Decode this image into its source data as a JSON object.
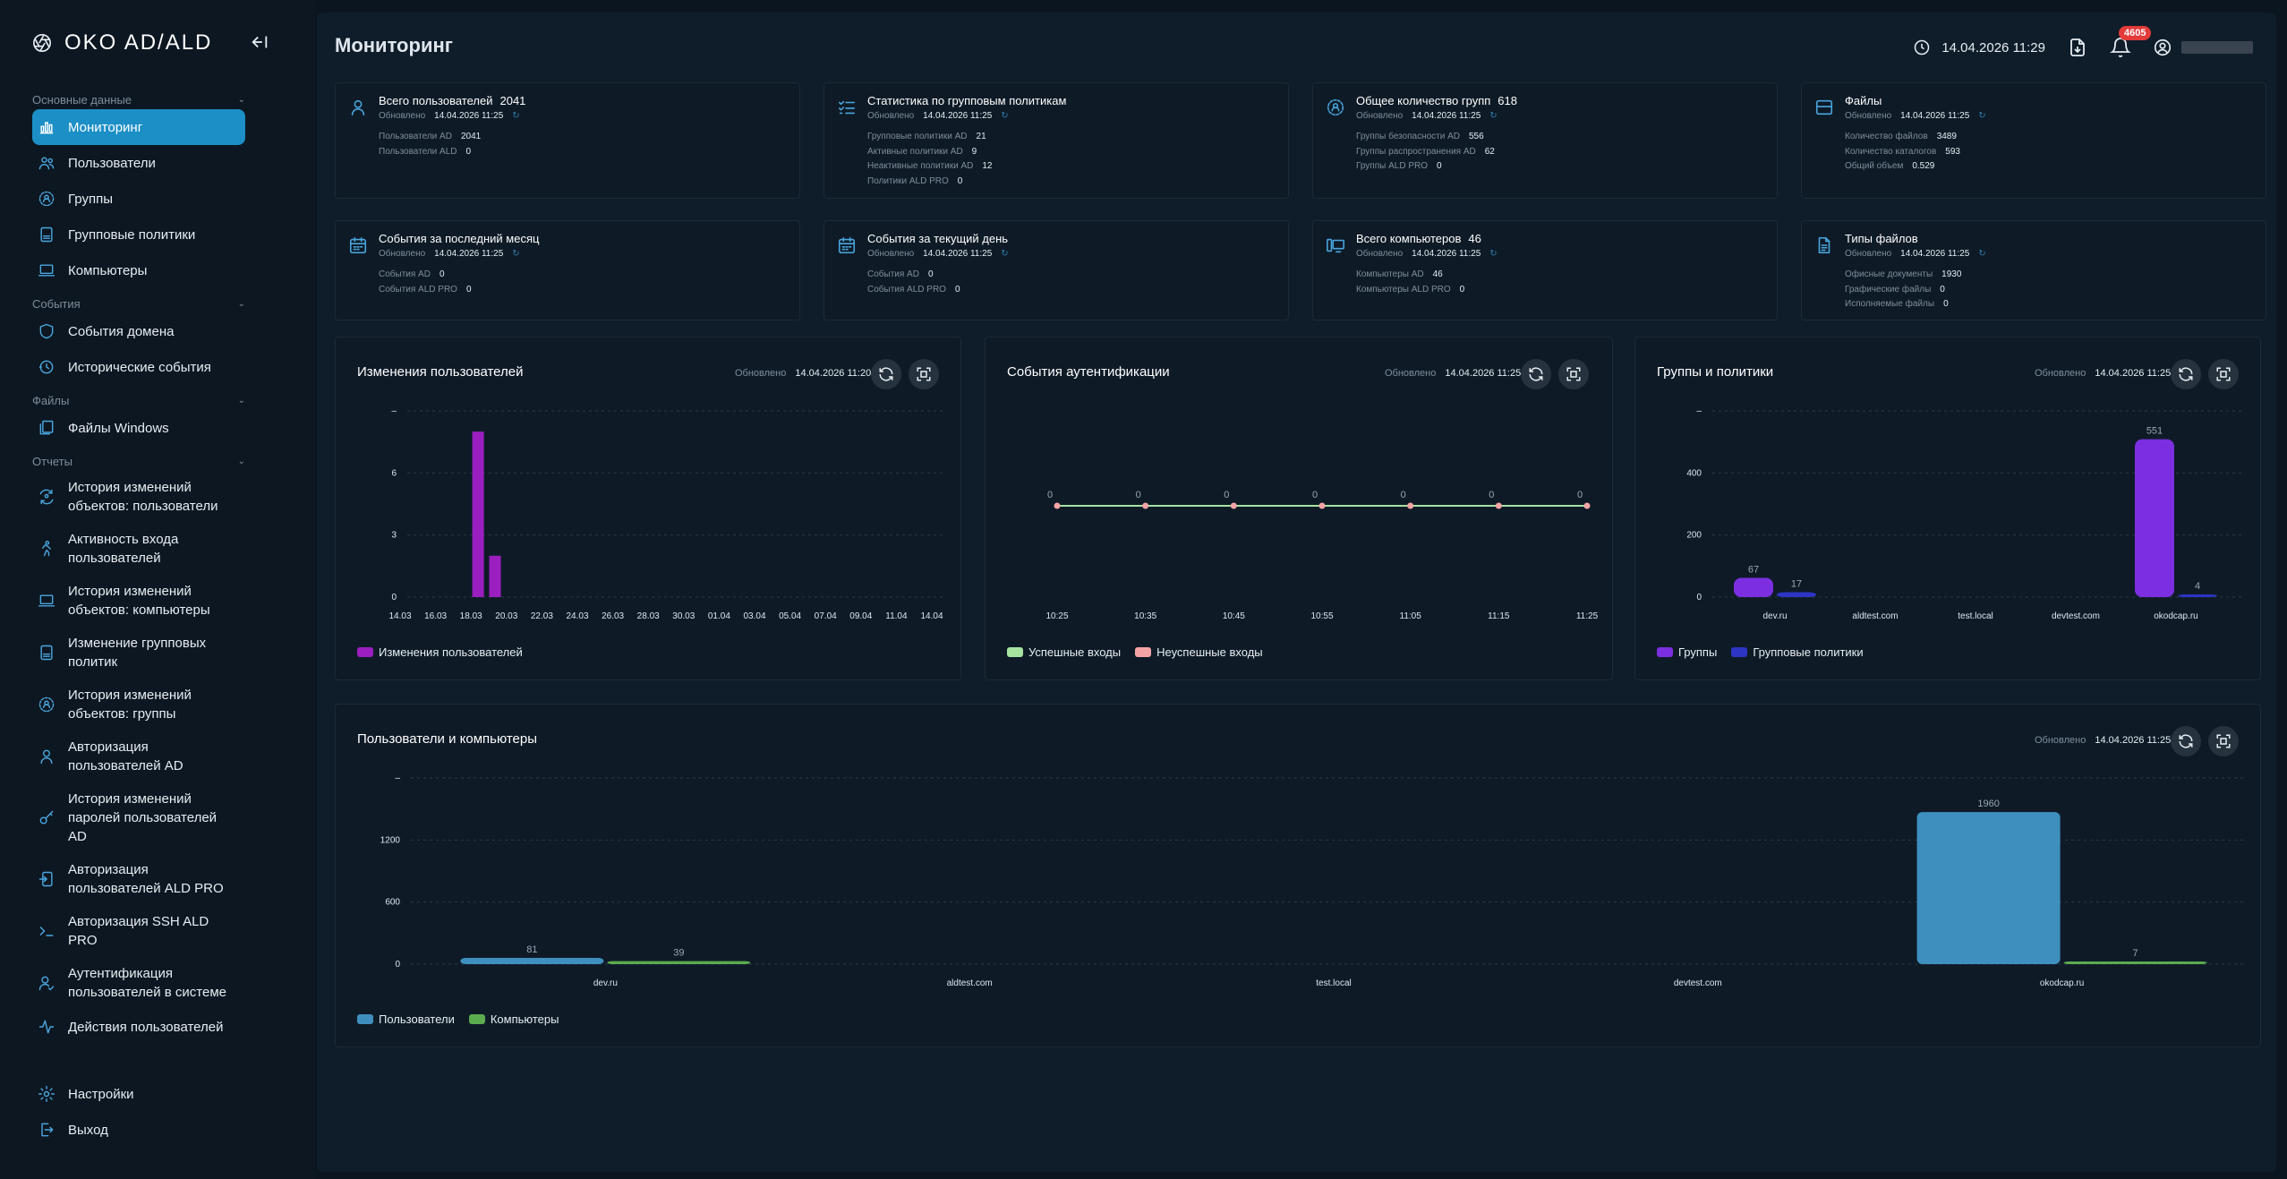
{
  "sidebar": {
    "brand": "OKO AD/ALD",
    "sections": [
      {
        "label": "Основные данные",
        "items": [
          {
            "label": "Мониторинг",
            "icon": "chart-bar-icon",
            "active": true
          },
          {
            "label": "Пользователи",
            "icon": "users-icon"
          },
          {
            "label": "Группы",
            "icon": "group-icon"
          },
          {
            "label": "Групповые политики",
            "icon": "policy-icon"
          },
          {
            "label": "Компьютеры",
            "icon": "laptop-icon"
          }
        ]
      },
      {
        "label": "События",
        "items": [
          {
            "label": "События домена",
            "icon": "shield-icon"
          },
          {
            "label": "Исторические события",
            "icon": "history-icon"
          }
        ]
      },
      {
        "label": "Файлы",
        "items": [
          {
            "label": "Файлы Windows",
            "icon": "files-icon"
          }
        ]
      },
      {
        "label": "Отчеты",
        "items": [
          {
            "label": "История изменений объектов: пользователи",
            "icon": "user-sync-icon"
          },
          {
            "label": "Активность входа пользователей",
            "icon": "walk-icon"
          },
          {
            "label": "История изменений объектов: компьютеры",
            "icon": "laptop-icon"
          },
          {
            "label": "Изменение групповых политик",
            "icon": "policy-icon"
          },
          {
            "label": "История изменений объектов: группы",
            "icon": "group-icon"
          },
          {
            "label": "Авторизация пользователей AD",
            "icon": "user-icon"
          },
          {
            "label": "История изменений паролей пользователей AD",
            "icon": "key-icon"
          },
          {
            "label": "Авторизация пользователей ALD PRO",
            "icon": "login-icon"
          },
          {
            "label": "Авторизация SSH ALD PRO",
            "icon": "terminal-icon"
          },
          {
            "label": "Аутентификация пользователей в системе",
            "icon": "user-check-icon"
          },
          {
            "label": "Действия пользователей",
            "icon": "activity-icon"
          }
        ]
      }
    ],
    "bottom": [
      {
        "label": "Настройки",
        "icon": "gear-icon"
      },
      {
        "label": "Выход",
        "icon": "logout-icon"
      }
    ]
  },
  "header": {
    "title": "Мониторинг",
    "datetime": "14.04.2026 11:29",
    "notifications": "4605"
  },
  "stats": [
    {
      "title": "Всего пользователей",
      "value": "2041",
      "updated_label": "Обновлено",
      "updated": "14.04.2026 11:25",
      "icon": "user-icon",
      "rows": [
        {
          "k": "Пользователи AD",
          "v": "2041"
        },
        {
          "k": "Пользователи ALD",
          "v": "0"
        }
      ]
    },
    {
      "title": "Статистика по групповым политикам",
      "value": "",
      "updated_label": "Обновлено",
      "updated": "14.04.2026 11:25",
      "icon": "checklist-icon",
      "rows": [
        {
          "k": "Групповые политики AD",
          "v": "21"
        },
        {
          "k": "Активные политики AD",
          "v": "9"
        },
        {
          "k": "Неактивные политики AD",
          "v": "12"
        },
        {
          "k": "Политики ALD PRO",
          "v": "0"
        }
      ]
    },
    {
      "title": "Общее количество групп",
      "value": "618",
      "updated_label": "Обновлено",
      "updated": "14.04.2026 11:25",
      "icon": "group-icon",
      "rows": [
        {
          "k": "Группы безопасности AD",
          "v": "556"
        },
        {
          "k": "Группы распространения AD",
          "v": "62"
        },
        {
          "k": "Группы ALD PRO",
          "v": "0"
        }
      ]
    },
    {
      "title": "Файлы",
      "value": "",
      "updated_label": "Обновлено",
      "updated": "14.04.2026 11:25",
      "icon": "storage-icon",
      "rows": [
        {
          "k": "Количество файлов",
          "v": "3489"
        },
        {
          "k": "Количество каталогов",
          "v": "593"
        },
        {
          "k": "Общий объем",
          "v": "0.529"
        }
      ]
    },
    {
      "title": "События за последний месяц",
      "value": "",
      "updated_label": "Обновлено",
      "updated": "14.04.2026 11:25",
      "icon": "calendar-icon",
      "rows": [
        {
          "k": "События AD",
          "v": "0"
        },
        {
          "k": "События ALD PRO",
          "v": "0"
        }
      ]
    },
    {
      "title": "События за текущий день",
      "value": "",
      "updated_label": "Обновлено",
      "updated": "14.04.2026 11:25",
      "icon": "calendar-icon",
      "rows": [
        {
          "k": "События AD",
          "v": "0"
        },
        {
          "k": "События ALD PRO",
          "v": "0"
        }
      ]
    },
    {
      "title": "Всего компьютеров",
      "value": "46",
      "updated_label": "Обновлено",
      "updated": "14.04.2026 11:25",
      "icon": "devices-icon",
      "rows": [
        {
          "k": "Компьютеры AD",
          "v": "46"
        },
        {
          "k": "Компьютеры ALD PRO",
          "v": "0"
        }
      ]
    },
    {
      "title": "Типы файлов",
      "value": "",
      "updated_label": "Обновлено",
      "updated": "14.04.2026 11:25",
      "icon": "file-icon",
      "rows": [
        {
          "k": "Офисные документы",
          "v": "1930"
        },
        {
          "k": "Графические файлы",
          "v": "0"
        },
        {
          "k": "Исполняемые файлы",
          "v": "0"
        }
      ]
    }
  ],
  "panels": {
    "user_changes": {
      "title": "Изменения пользователей",
      "updated_label": "Обновлено",
      "updated": "14.04.2026 11:20"
    },
    "auth_events": {
      "title": "События аутентификации",
      "updated_label": "Обновлено",
      "updated": "14.04.2026 11:25"
    },
    "groups_policies": {
      "title": "Группы и политики",
      "updated_label": "Обновлено",
      "updated": "14.04.2026 11:25"
    },
    "users_computers": {
      "title": "Пользователи и компьютеры",
      "updated_label": "Обновлено",
      "updated": "14.04.2026 11:25"
    }
  },
  "chart_data": [
    {
      "id": "user_changes",
      "type": "bar",
      "categories": [
        "14.03",
        "15.03",
        "16.03",
        "17.03",
        "18.03",
        "19.03",
        "20.03",
        "21.03",
        "22.03",
        "23.03",
        "24.03",
        "25.03",
        "26.03",
        "27.03",
        "28.03",
        "29.03",
        "30.03",
        "31.03",
        "01.04",
        "02.04",
        "03.04",
        "04.04",
        "05.04",
        "06.04",
        "07.04",
        "08.04",
        "09.04",
        "10.04",
        "11.04",
        "12.04",
        "13.04",
        "14.04"
      ],
      "tick_labels": [
        "14.03",
        "16.03",
        "18.03",
        "20.03",
        "22.03",
        "24.03",
        "26.03",
        "28.03",
        "30.03",
        "01.04",
        "03.04",
        "05.04",
        "07.04",
        "09.04",
        "11.04",
        "14.04"
      ],
      "series": [
        {
          "name": "Изменения пользователей",
          "color": "#9b1fc0",
          "values": [
            0,
            0,
            0,
            0,
            8,
            2,
            0,
            0,
            0,
            0,
            0,
            0,
            0,
            0,
            0,
            0,
            0,
            0,
            0,
            0,
            0,
            0,
            0,
            0,
            0,
            0,
            0,
            0,
            0,
            0,
            0,
            0
          ]
        }
      ],
      "yticks": [
        "0",
        "3",
        "6",
        "–"
      ],
      "ylim": [
        0,
        9
      ]
    },
    {
      "id": "auth_events",
      "type": "line",
      "categories": [
        "10:25",
        "10:35",
        "10:45",
        "10:55",
        "11:05",
        "11:15",
        "11:25"
      ],
      "series": [
        {
          "name": "Успешные входы",
          "color": "#a6e3a1",
          "values": [
            0,
            0,
            0,
            0,
            0,
            0,
            0
          ]
        },
        {
          "name": "Неуспешные входы",
          "color": "#f4a4a4",
          "values": [
            0,
            0,
            0,
            0,
            0,
            0,
            0
          ]
        }
      ],
      "point_labels": [
        "0",
        "0",
        "0",
        "0",
        "0",
        "0",
        "0"
      ]
    },
    {
      "id": "groups_policies",
      "type": "bar",
      "categories": [
        "dev.ru",
        "aldtest.com",
        "test.local",
        "devtest.com",
        "okodcap.ru"
      ],
      "series": [
        {
          "name": "Группы",
          "color": "#7b2fe0",
          "values": [
            67,
            0,
            0,
            0,
            551
          ],
          "labels": [
            "67",
            "",
            "",
            "",
            "551"
          ]
        },
        {
          "name": "Групповые политики",
          "color": "#2c35c4",
          "values": [
            17,
            0,
            0,
            0,
            4
          ],
          "labels": [
            "17",
            "",
            "",
            "",
            "4"
          ]
        }
      ],
      "yticks": [
        "0",
        "200",
        "400",
        "–"
      ],
      "ylim": [
        0,
        650
      ]
    },
    {
      "id": "users_computers",
      "type": "bar",
      "categories": [
        "dev.ru",
        "aldtest.com",
        "test.local",
        "devtest.com",
        "okodcap.ru"
      ],
      "series": [
        {
          "name": "Пользователи",
          "color": "#3f8fbe",
          "values": [
            81,
            0,
            0,
            0,
            1960
          ],
          "labels": [
            "81",
            "",
            "",
            "",
            "1960"
          ]
        },
        {
          "name": "Компьютеры",
          "color": "#5cab4e",
          "values": [
            39,
            0,
            0,
            0,
            7
          ],
          "labels": [
            "39",
            "",
            "",
            "",
            "7"
          ]
        }
      ],
      "yticks": [
        "0",
        "600",
        "1200",
        "–"
      ],
      "ylim": [
        0,
        2400
      ]
    }
  ]
}
